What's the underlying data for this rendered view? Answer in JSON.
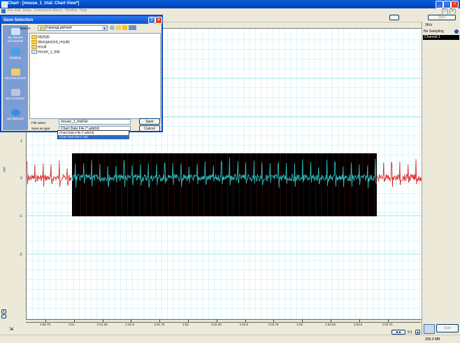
{
  "window": {
    "title": "Chart - [mouse_1_trial: Chart View*]",
    "menu": [
      "File",
      "Edit",
      "Setup",
      "Commands",
      "Macro",
      "Window",
      "Help"
    ]
  },
  "toolbar": {
    "start_label": "Start",
    "scale_label": "2K/s"
  },
  "right_panel": {
    "sampling": "No Sampling",
    "channel": "Channel 1",
    "start_button": "Start",
    "memory": "299.3 MB"
  },
  "chart": {
    "y_unit": "mV",
    "y_ticks": [
      "2",
      "1",
      "0",
      "-1",
      "-2"
    ],
    "x_ticks": [
      "1:00.75",
      "1:01",
      "1:01.25",
      "1:01.5",
      "1:01.75",
      "1:02",
      "1:02.25",
      "1:02.5",
      "1:02.75",
      "1:03",
      "1:03.25",
      "1:03.5",
      "1:03.75"
    ],
    "zoom_label": "5:1",
    "signal_color": "#e01c1c",
    "selection_color": "#30c8c8"
  },
  "dialog": {
    "title": "Save Selection",
    "save_in_label": "Save in:",
    "save_in_value": "TrainingLabFeb4",
    "files": [
      "062530",
      "disorganized_results",
      "result",
      "mouse_1_trial"
    ],
    "places": [
      "My Recent Documents",
      "Desktop",
      "My Documents",
      "My Computer",
      "My Network"
    ],
    "file_name_label": "File name:",
    "file_name_value": "mouse_1_trialSel",
    "save_type_label": "Save as type:",
    "save_type_value": "Chart Data File (*.adicht)",
    "type_options": [
      "Chart Data File (*.adicht)",
      "Chart Text File (*.txt)"
    ],
    "save_button": "Save",
    "cancel_button": "Cancel"
  }
}
